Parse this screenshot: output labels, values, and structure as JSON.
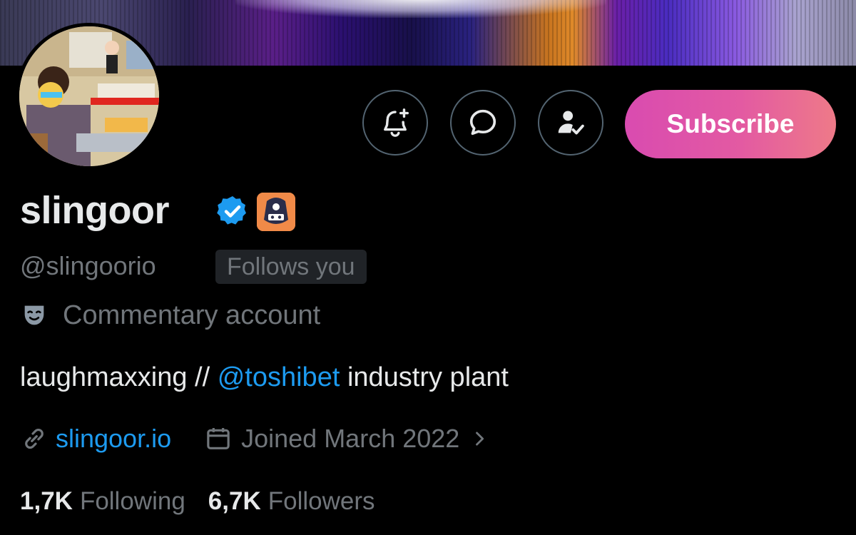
{
  "header": {
    "banner_colors": [
      "#3a3a55",
      "#5a1f88",
      "#18104a",
      "#e08a2a",
      "#4a2cc0",
      "#a9a3cf"
    ]
  },
  "actions": {
    "notify_icon": "bell-plus-icon",
    "message_icon": "message-bubble-icon",
    "following_icon": "user-check-icon",
    "subscribe_label": "Subscribe",
    "subscribe_gradient": [
      "#d94bb0",
      "#ee7a88"
    ]
  },
  "profile": {
    "display_name": "slingoor",
    "verified_icon": "verified-badge-icon",
    "affiliate_icon": "affiliate-badge-icon",
    "handle": "@slingoorio",
    "follows_you": "Follows you",
    "account_label": "Commentary account",
    "account_label_icon": "theater-mask-icon",
    "bio": {
      "prefix": "laughmaxxing // ",
      "mention": "@toshibet",
      "suffix": " industry plant"
    },
    "website": "slingoor.io",
    "website_icon": "link-icon",
    "joined": "Joined March 2022",
    "joined_icon": "calendar-icon",
    "stats": {
      "following_count": "1,7K",
      "following_label": "Following",
      "followers_count": "6,7K",
      "followers_label": "Followers"
    }
  },
  "colors": {
    "background": "#000000",
    "text_primary": "#e7e9ea",
    "text_secondary": "#71767b",
    "link": "#1d9bf0",
    "verified": "#1d9bf0",
    "button_border": "#536471"
  }
}
